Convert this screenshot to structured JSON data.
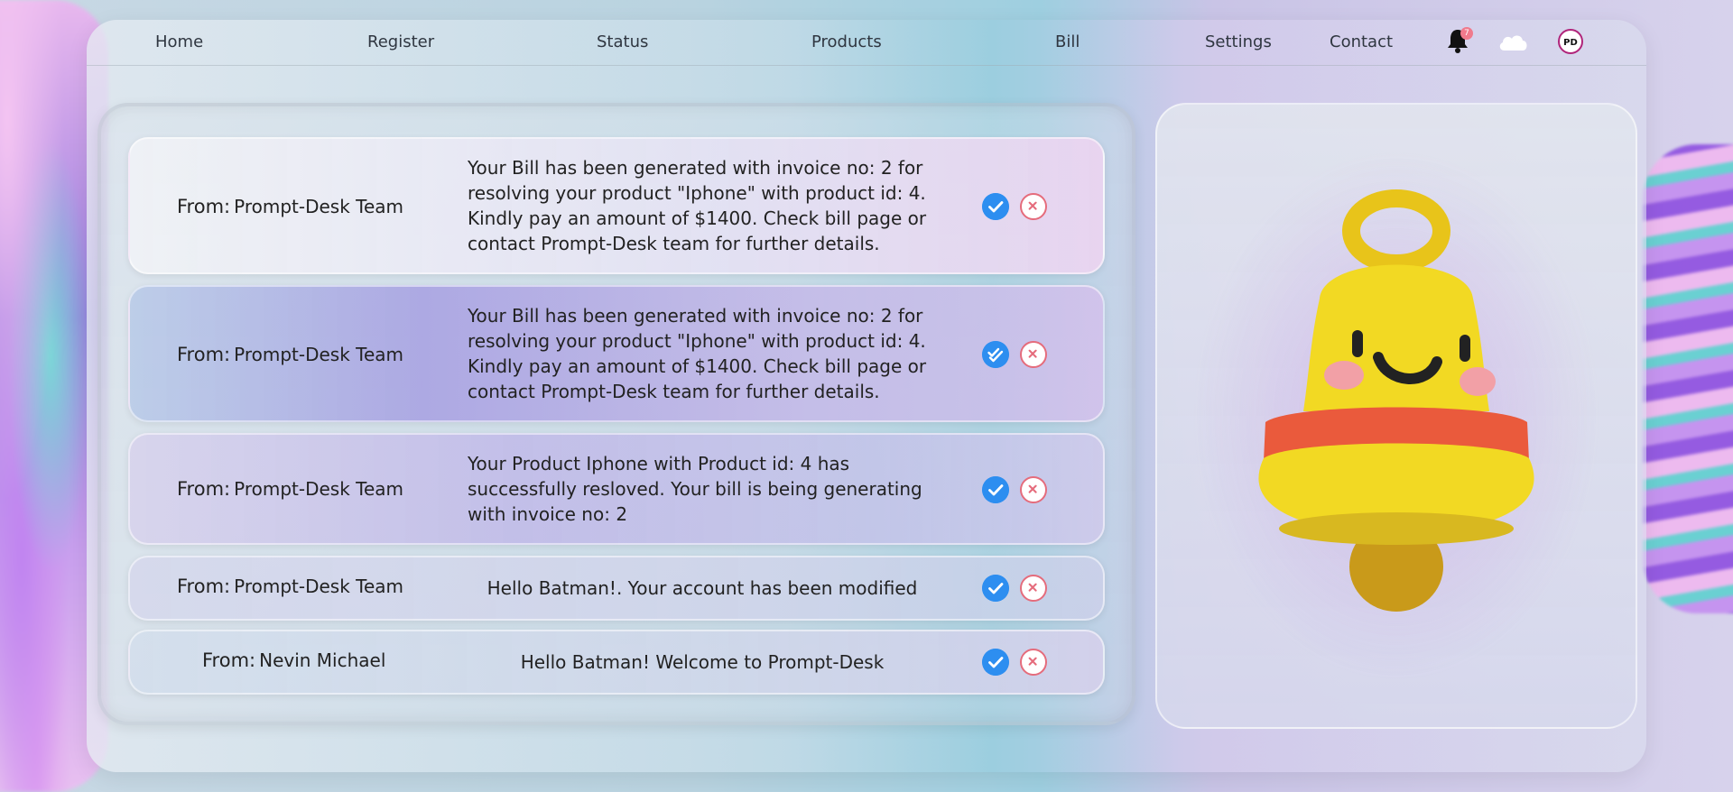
{
  "nav": {
    "items": [
      "Home",
      "Register",
      "Status",
      "Products",
      "Bill",
      "Settings",
      "Contact"
    ],
    "bell_badge": "7",
    "avatar_initials": "PD"
  },
  "notifications": [
    {
      "from_label": "From:",
      "sender": "Prompt-Desk Team",
      "message": "Your Bill has been generated with invoice no: 2 for resolving your product \"Iphone\" with product id: 4. Kindly pay an amount of $1400. Check bill page or contact Prompt-Desk team for further details.",
      "status": "read"
    },
    {
      "from_label": "From:",
      "sender": "Prompt-Desk Team",
      "message": "Your Bill has been generated with invoice no: 2 for resolving your product \"Iphone\" with product id: 4. Kindly pay an amount of $1400. Check bill page or contact Prompt-Desk team for further details.",
      "status": "double-check"
    },
    {
      "from_label": "From:",
      "sender": "Prompt-Desk Team",
      "message": "Your Product Iphone with Product id: 4 has successfully resloved. Your bill is being generating with invoice no: 2",
      "status": "read"
    },
    {
      "from_label": "From:",
      "sender": "Prompt-Desk Team",
      "message": "Hello Batman!. Your account has been modified",
      "status": "read"
    },
    {
      "from_label": "From:",
      "sender": "Nevin Michael",
      "message": "Hello Batman! Welcome to Prompt-Desk",
      "status": "read"
    }
  ],
  "colors": {
    "accept": "#2d8ef0",
    "reject": "#e56c7c",
    "bell_yellow": "#f2d923",
    "bell_band": "#ea5a3c"
  },
  "icons": {
    "accept": "check-icon",
    "accept_double": "double-check-icon",
    "reject": "close-icon",
    "bell": "bell-icon",
    "cloud": "cloud-icon"
  }
}
